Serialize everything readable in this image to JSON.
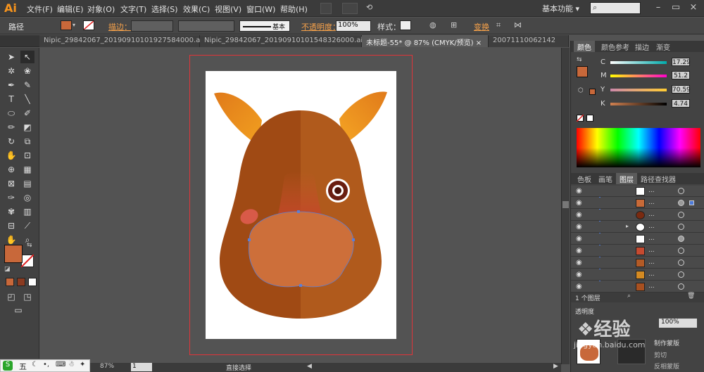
{
  "app": {
    "logo": "Ai",
    "workspace": "基本功能",
    "workspace_arrow": "▾"
  },
  "menu": [
    "文件(F)",
    "编辑(E)",
    "对象(O)",
    "文字(T)",
    "选择(S)",
    "效果(C)",
    "视图(V)",
    "窗口(W)",
    "帮助(H)"
  ],
  "control_bar": {
    "selection_label": "路径",
    "stroke_label": "描边：",
    "stroke_profile": "基本",
    "opacity_label": "不透明度：",
    "opacity_value": "100%",
    "style_label": "样式：",
    "transform_label": "变换"
  },
  "tabs": [
    {
      "label": "Nipic_29842067_20190910101927584000.ai*",
      "close": "×"
    },
    {
      "label": "Nipic_29842067_20190910101548326000.ai*",
      "close": "×"
    },
    {
      "label": "未标题-55* @ 87% (CMYK/预览)",
      "close": "×"
    },
    {
      "label": "20071110062142",
      "close": ""
    }
  ],
  "color_panel": {
    "tabs": [
      "颜色",
      "颜色参考",
      "描边",
      "渐变"
    ],
    "channels": [
      {
        "name": "C",
        "value": "17.29"
      },
      {
        "name": "M",
        "value": "51.2"
      },
      {
        "name": "Y",
        "value": "70.59"
      },
      {
        "name": "K",
        "value": "4.74"
      }
    ]
  },
  "layers_panel": {
    "tabs": [
      "色板",
      "画笔",
      "图层",
      "路径查找器"
    ],
    "row_dots": "...",
    "footer_label": "1 个图层",
    "rows": [
      {
        "thumb": "#ffffff"
      },
      {
        "thumb": "#c86a38"
      },
      {
        "thumb": "#7a2a10"
      },
      {
        "thumb": "#ffffff",
        "expand": "▸"
      },
      {
        "thumb": "#ffffff"
      },
      {
        "thumb": "#c64a30"
      },
      {
        "thumb": "#b35a26"
      },
      {
        "thumb": "#d48a22"
      },
      {
        "thumb": "#a85020"
      }
    ]
  },
  "bottom_panel": {
    "title": "透明度",
    "opacity": "100%",
    "make_mask": "制作蒙版",
    "clip": "剪切",
    "invert": "反相蒙版"
  },
  "status_bar": {
    "zoom": "87%",
    "page": "1",
    "tool": "直接选择"
  },
  "watermark": {
    "text": "经验",
    "domain": "jingyan.baidu.com"
  },
  "taskbar": {
    "ime": "五"
  },
  "colors": {
    "fill": "#c8683a",
    "accent_orange": "#f7941d",
    "artboard_border": "#e0353a"
  }
}
